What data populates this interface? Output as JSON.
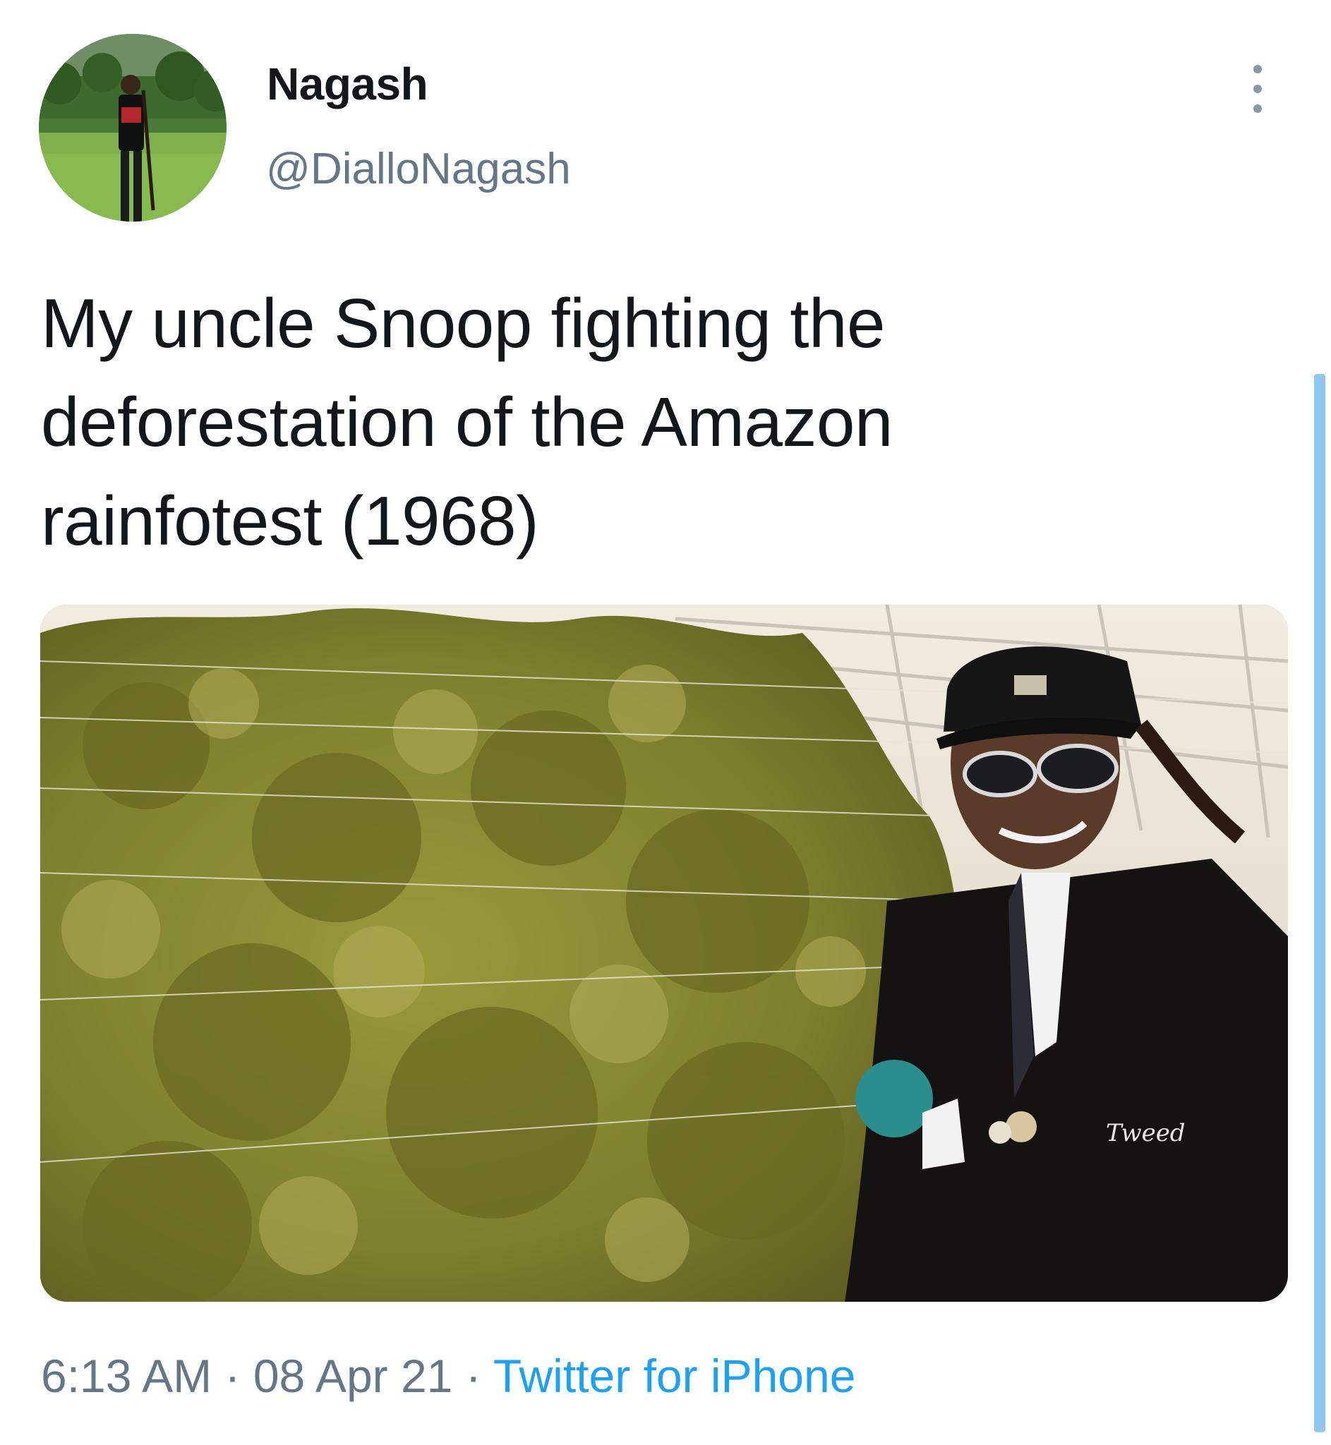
{
  "user": {
    "display_name": "Nagash",
    "handle": "@DialloNagash"
  },
  "tweet": {
    "text": "My uncle Snoop fighting the deforestation of the Amazon rainfotest (1968)",
    "lines": [
      "My uncle Snoop fighting the",
      "deforestation of the Amazon",
      "rainfotest (1968)"
    ]
  },
  "media": {
    "jacket_logo": "Tweed"
  },
  "meta": {
    "time": "6:13 AM",
    "separator": " · ",
    "date": "08 Apr 21",
    "source": "Twitter for iPhone"
  },
  "icons": {
    "more": "more-vertical-icon"
  },
  "colors": {
    "text": "#14171a",
    "secondary": "#657786",
    "link": "#1da1f2",
    "scrollbar": "#8ec7f0"
  }
}
